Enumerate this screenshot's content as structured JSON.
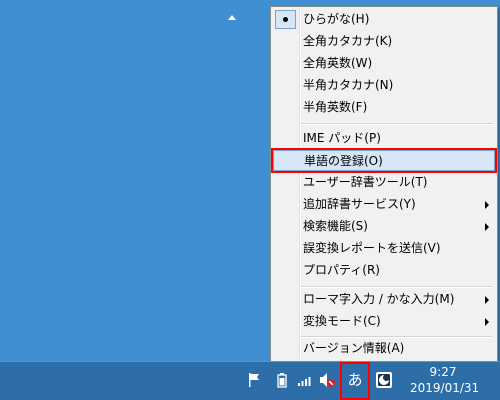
{
  "menu": {
    "items": [
      {
        "label": "ひらがな(H)",
        "checked": true
      },
      {
        "label": "全角カタカナ(K)"
      },
      {
        "label": "全角英数(W)"
      },
      {
        "label": "半角カタカナ(N)"
      },
      {
        "label": "半角英数(F)"
      },
      {
        "label": "IME パッド(P)"
      },
      {
        "label": "単語の登録(O)",
        "selected": true
      },
      {
        "label": "ユーザー辞書ツール(T)"
      },
      {
        "label": "追加辞書サービス(Y)",
        "submenu": true
      },
      {
        "label": "検索機能(S)",
        "submenu": true
      },
      {
        "label": "誤変換レポートを送信(V)"
      },
      {
        "label": "プロパティ(R)"
      },
      {
        "label": "ローマ字入力 / かな入力(M)",
        "submenu": true
      },
      {
        "label": "変換モード(C)",
        "submenu": true
      },
      {
        "label": "バージョン情報(A)"
      }
    ]
  },
  "taskbar": {
    "ime_mode": "あ",
    "clock": {
      "time": "9:27",
      "date": "2019/01/31"
    },
    "tray_icons": [
      "show-hidden-icons",
      "flag-icon",
      "battery-icon",
      "network-signal-icon",
      "volume-muted-icon",
      "ime-mode-icon",
      "ime-pad-icon"
    ]
  },
  "colors": {
    "desktop": "#3f8fd2",
    "taskbar": "#2d6ea9",
    "menu_bg": "#f1f1f1",
    "highlight": "#ff0000",
    "selection": "#d6e6f6"
  }
}
